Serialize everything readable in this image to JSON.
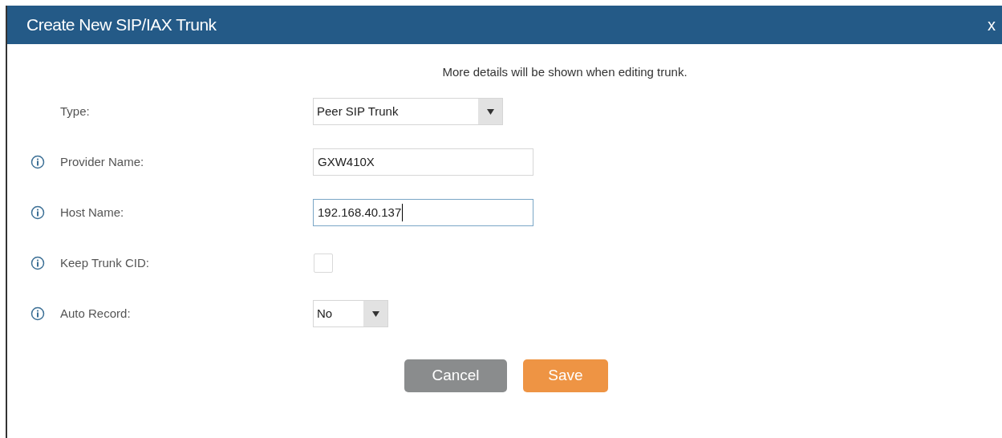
{
  "dialog": {
    "title": "Create New SIP/IAX Trunk",
    "close": "x"
  },
  "note": "More details will be shown when editing trunk.",
  "fields": [
    {
      "label": "Type:",
      "info": false,
      "kind": "select",
      "value": "Peer SIP Trunk"
    },
    {
      "label": "Provider Name:",
      "info": true,
      "kind": "text",
      "value": "GXW410X",
      "focused": false
    },
    {
      "label": "Host Name:",
      "info": true,
      "kind": "text",
      "value": "192.168.40.137",
      "focused": true
    },
    {
      "label": "Keep Trunk CID:",
      "info": true,
      "kind": "checkbox",
      "checked": false
    },
    {
      "label": "Auto Record:",
      "info": true,
      "kind": "select",
      "value": "No"
    }
  ],
  "buttons": [
    {
      "label": "Cancel",
      "kind": "cancel"
    },
    {
      "label": "Save",
      "kind": "save"
    }
  ]
}
